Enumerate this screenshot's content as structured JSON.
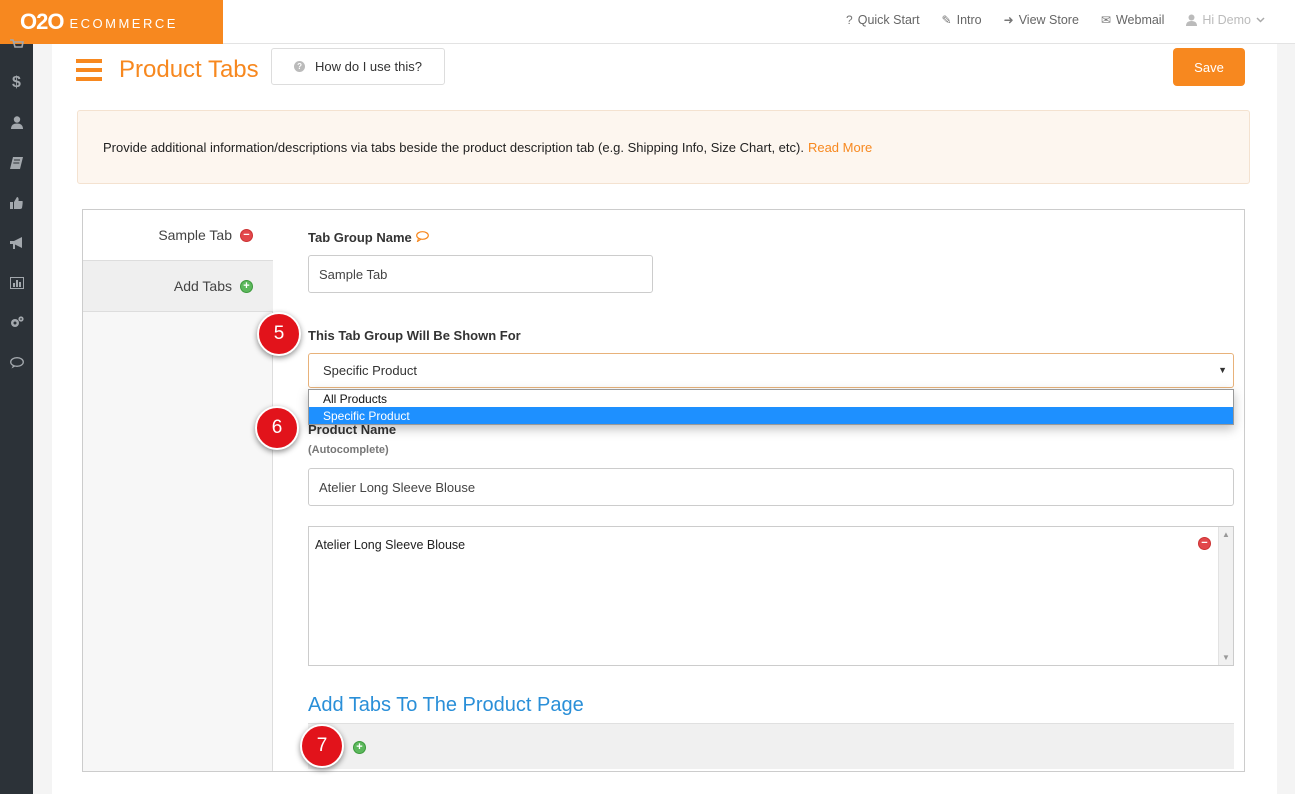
{
  "topbar": {
    "logo_main": "O2O",
    "logo_sub": "ECOMMERCE",
    "nav": [
      {
        "icon": "question-icon",
        "glyph": "?",
        "label": "Quick Start"
      },
      {
        "icon": "wand-icon",
        "glyph": "✎",
        "label": "Intro"
      },
      {
        "icon": "sign-in-icon",
        "glyph": "➜",
        "label": "View Store"
      },
      {
        "icon": "envelope-icon",
        "glyph": "✉",
        "label": "Webmail"
      }
    ],
    "user_label": "Hi Demo"
  },
  "sidebar_icons": [
    "cart-icon",
    "dollar-icon",
    "user-icon",
    "book-icon",
    "thumbs-up-icon",
    "megaphone-icon",
    "chart-icon",
    "gears-icon",
    "comment-icon"
  ],
  "header": {
    "title": "Product Tabs",
    "help_label": "How do I use this?",
    "save_label": "Save"
  },
  "info": {
    "text": "Provide additional information/descriptions via tabs beside the product description tab (e.g. Shipping Info, Size Chart, etc).",
    "read_more": "Read More"
  },
  "tabs": {
    "items": [
      {
        "label": "Sample Tab"
      },
      {
        "label": "Add Tabs"
      }
    ]
  },
  "form": {
    "group_name_label": "Tab Group Name",
    "group_name_value": "Sample Tab",
    "shown_for_label": "This Tab Group Will Be Shown For",
    "shown_for_value": "Specific Product",
    "options": [
      "All Products",
      "Specific Product"
    ],
    "product_name_label": "Product Name",
    "product_name_sub": "(Autocomplete)",
    "product_name_value": "Atelier Long Sleeve Blouse",
    "selected_products": [
      "Atelier Long Sleeve Blouse"
    ],
    "add_tabs_title": "Add Tabs To The Product Page"
  },
  "steps": [
    "5",
    "6",
    "7"
  ],
  "colors": {
    "accent": "#f7881f",
    "link_blue": "#2a8fd8",
    "step_red": "#e2131b",
    "selection_blue": "#1e90ff"
  }
}
